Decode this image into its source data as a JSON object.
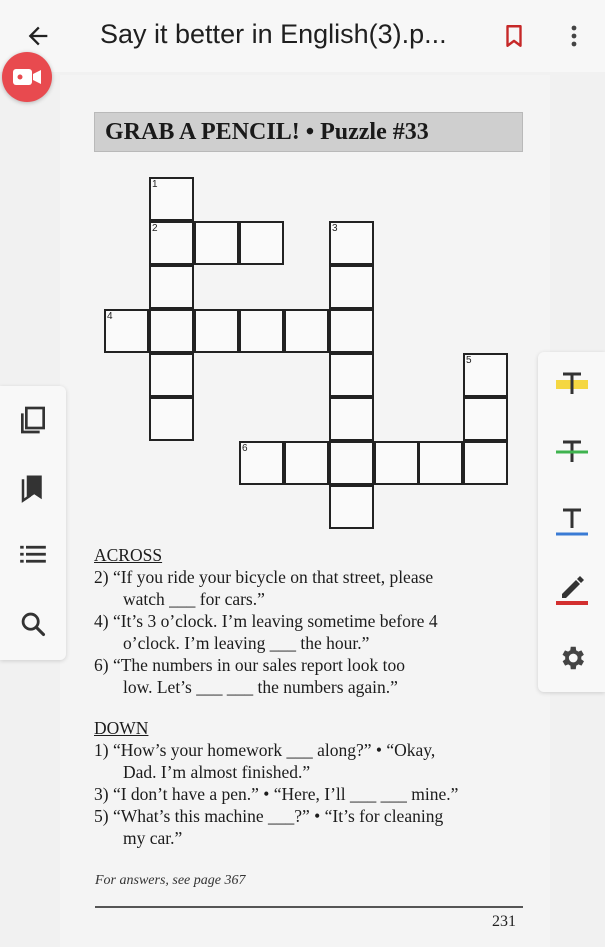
{
  "toolbar": {
    "title": "Say it better in English(3).p...",
    "back_icon": "arrow-left-icon",
    "bookmark_icon": "bookmark-outline-icon",
    "more_icon": "more-vert-icon",
    "bookmark_color": "#c62828"
  },
  "recording": {
    "icon": "video-camera-icon",
    "color": "#e84a4f"
  },
  "puzzle": {
    "title": "GRAB A PENCIL! • Puzzle #33",
    "numbers": {
      "n1": "1",
      "n2": "2",
      "n3": "3",
      "n4": "4",
      "n5": "5",
      "n6": "6"
    }
  },
  "across": {
    "heading": "ACROSS",
    "lines": [
      "2) “If you ride your bicycle on that street, please",
      "watch ___ for cars.”",
      "4) “It’s 3 o’clock. I’m leaving sometime before 4",
      "o’clock. I’m leaving ___ the hour.”",
      "6) “The numbers in our sales report look too",
      "low. Let’s ___ ___ the numbers again.”"
    ]
  },
  "down": {
    "heading": "DOWN",
    "lines": [
      "1) “How’s your homework ___ along?” • “Okay,",
      "Dad. I’m almost finished.”",
      "3) “I don’t have a pen.” • “Here, I’ll ___ ___ mine.”",
      "5) “What’s this machine ___?” • “It’s for cleaning",
      "my car.”"
    ]
  },
  "footer": {
    "answers_note": "For answers, see page 367",
    "page_number": "231"
  },
  "left_rail": {
    "icons": [
      "copy-pages-icon",
      "bookmarks-icon",
      "list-icon",
      "search-icon"
    ]
  },
  "right_rail": {
    "icons": [
      "highlight-text-icon",
      "strikethrough-text-icon",
      "underline-text-icon",
      "pen-draw-icon",
      "settings-icon"
    ],
    "colors": {
      "highlight": "#f5d742",
      "strike": "#3fb34f",
      "underline": "#3a7bd5",
      "pen": "#d32f2f"
    }
  }
}
